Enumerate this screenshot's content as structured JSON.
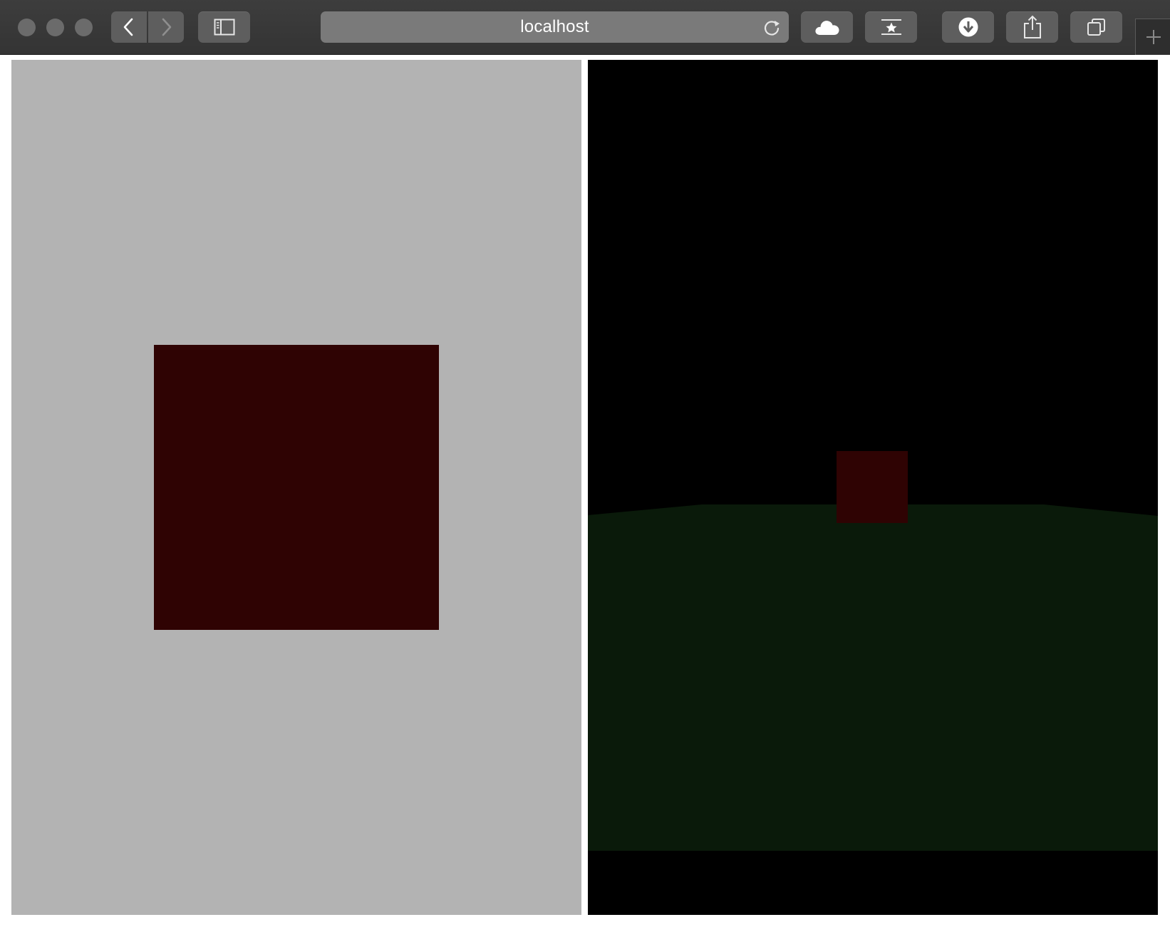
{
  "browser": {
    "address_bar": {
      "url": "localhost"
    },
    "toolbar_icons": [
      "back-icon",
      "forward-icon",
      "sidebar-icon",
      "reload-icon",
      "cloud-icon",
      "bookmark-star-icon",
      "download-icon",
      "share-icon",
      "tabs-overview-icon",
      "new-tab-icon"
    ]
  },
  "colors": {
    "left_background": "#b3b3b3",
    "left_square": "#2f0303",
    "right_background": "#000000",
    "ground": "#0a1a0a",
    "cube": "#2f0303"
  }
}
